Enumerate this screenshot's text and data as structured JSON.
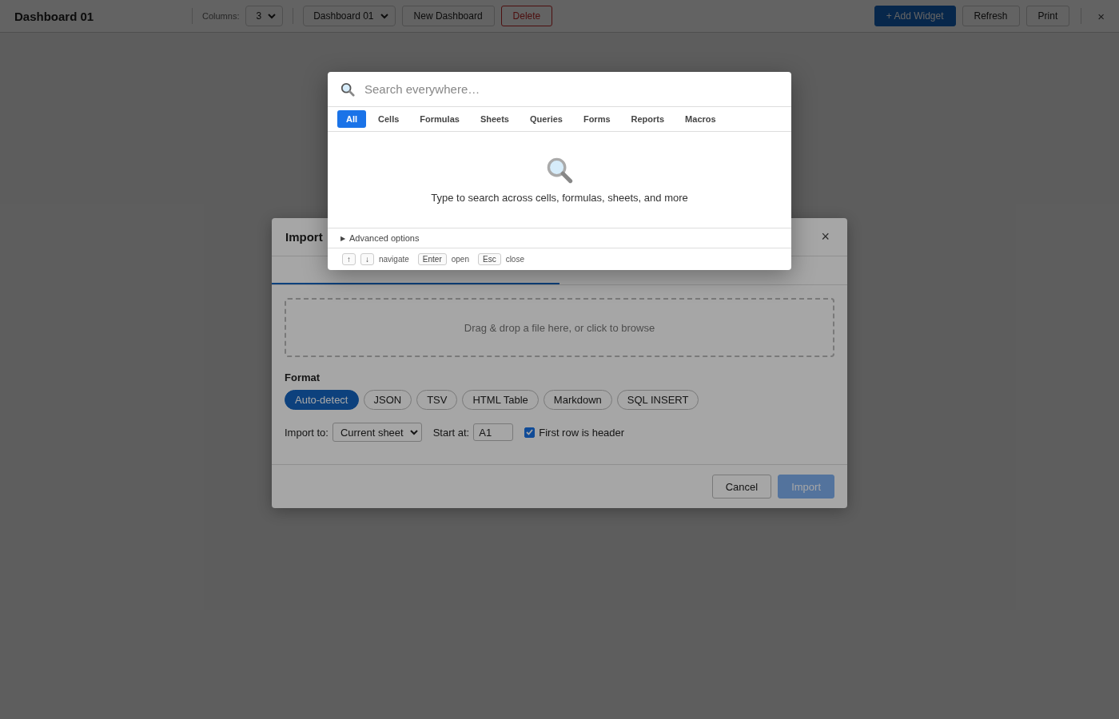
{
  "toolbar": {
    "title": "Dashboard 01",
    "columns_label": "Columns:",
    "columns_value": "3",
    "dashboard_select": "Dashboard 01",
    "buttons": [
      {
        "label": "New Dashboard",
        "kind": "plain"
      },
      {
        "label": "Delete",
        "kind": "danger"
      }
    ],
    "right_buttons": [
      {
        "label": "+ Add Widget",
        "kind": "primary"
      },
      {
        "label": "Refresh",
        "kind": "plain"
      },
      {
        "label": "Print",
        "kind": "plain"
      }
    ],
    "close": "×"
  },
  "import_dialog": {
    "title": "Import",
    "close": "×",
    "tabs": [
      {
        "selected": true
      },
      {
        "selected": false
      }
    ],
    "dropzone": "Drag & drop a file here, or click to browse",
    "format_label": "Format",
    "formats": [
      {
        "label": "Auto-detect",
        "selected": true
      },
      {
        "label": "JSON",
        "selected": false
      },
      {
        "label": "TSV",
        "selected": false
      },
      {
        "label": "HTML Table",
        "selected": false
      },
      {
        "label": "Markdown",
        "selected": false
      },
      {
        "label": "SQL INSERT",
        "selected": false
      }
    ],
    "import_to_label": "Import to:",
    "import_to_value": "Current sheet",
    "start_at_label": "Start at:",
    "start_at_value": "A1",
    "header_checkbox": {
      "label": "First row is header",
      "checked": true
    },
    "buttons": [
      {
        "label": "Cancel",
        "kind": "plain",
        "disabled": false
      },
      {
        "label": "Import",
        "kind": "primary",
        "disabled": true
      }
    ]
  },
  "search_palette": {
    "placeholder": "Search everywhere…",
    "filters": [
      {
        "label": "All",
        "selected": true
      },
      {
        "label": "Cells",
        "selected": false
      },
      {
        "label": "Formulas",
        "selected": false
      },
      {
        "label": "Sheets",
        "selected": false
      },
      {
        "label": "Queries",
        "selected": false
      },
      {
        "label": "Forms",
        "selected": false
      },
      {
        "label": "Reports",
        "selected": false
      },
      {
        "label": "Macros",
        "selected": false
      }
    ],
    "empty_message": "Type to search across cells, formulas, sheets, and more",
    "advanced": {
      "icon": "▶",
      "label": "Advanced options",
      "expanded": false
    },
    "hints": [
      {
        "keys": [
          "↑",
          "↓"
        ],
        "label": "navigate"
      },
      {
        "keys": [
          "Enter"
        ],
        "label": "open"
      },
      {
        "keys": [
          "Esc"
        ],
        "label": "close"
      }
    ]
  }
}
